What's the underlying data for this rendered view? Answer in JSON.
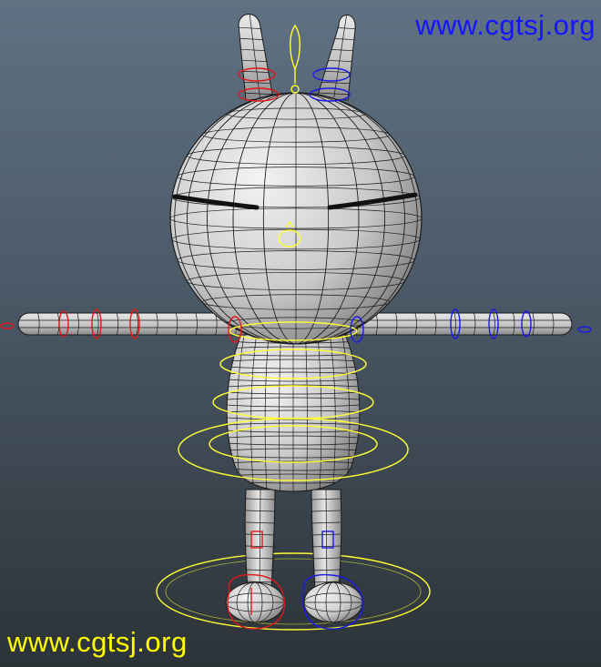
{
  "viewport": {
    "background_top": "#5f7283",
    "background_bottom": "#2c3338"
  },
  "model": {
    "subject": "rabbit-character-wireframe",
    "pose": "t-pose",
    "surface_color": "#d4d4d4",
    "wire_color": "#1a1a1a",
    "eye_color": "#111111"
  },
  "rig": {
    "center_control_color": "#ffff33",
    "left_control_color": "#e01818",
    "right_control_color": "#1a1ae6"
  },
  "watermarks": {
    "top_right": {
      "text": "www.cgtsj.org",
      "color": "#1414ff"
    },
    "bottom_left": {
      "text": "www.cgtsj.org",
      "color": "#ffff00"
    }
  }
}
